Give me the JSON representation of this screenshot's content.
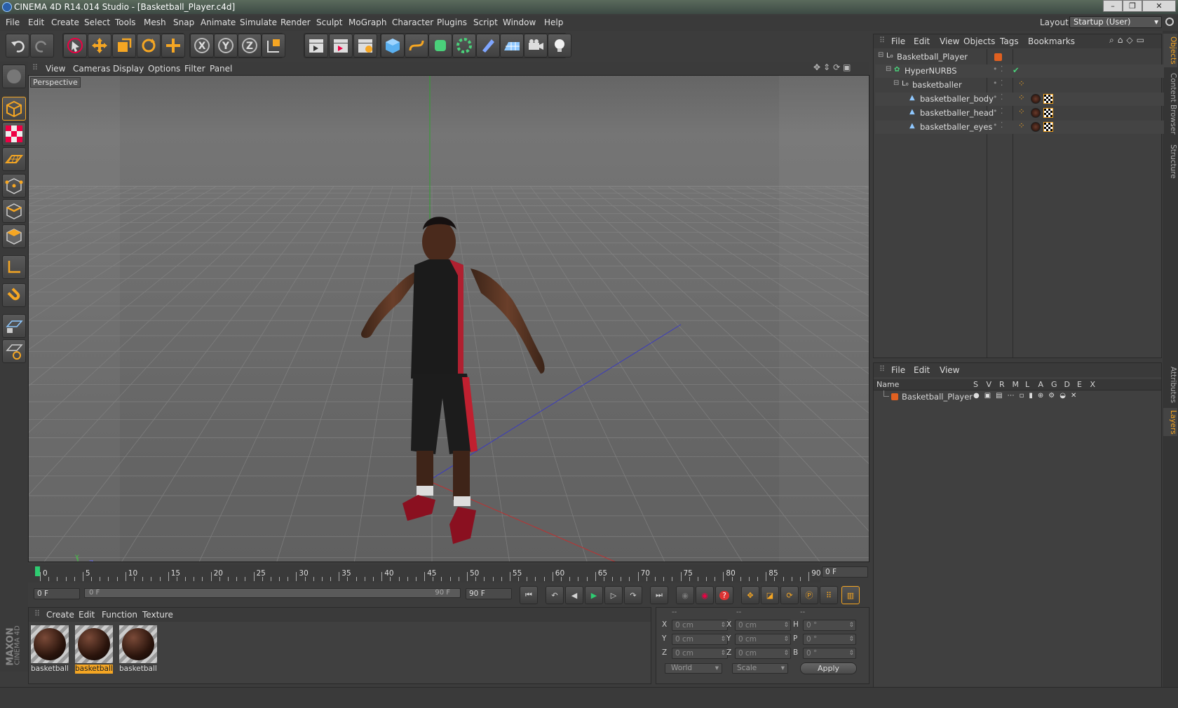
{
  "window": {
    "title": "CINEMA 4D R14.014 Studio - [Basketball_Player.c4d]"
  },
  "menu": [
    "File",
    "Edit",
    "Create",
    "Select",
    "Tools",
    "Mesh",
    "Snap",
    "Animate",
    "Simulate",
    "Render",
    "Sculpt",
    "MoGraph",
    "Character",
    "Plugins",
    "Script",
    "Window",
    "Help"
  ],
  "layout": {
    "label": "Layout:",
    "value": "Startup (User)"
  },
  "viewport": {
    "menu": [
      "View",
      "Cameras",
      "Display",
      "Options",
      "Filter",
      "Panel"
    ],
    "label": "Perspective",
    "axis_y": "Y",
    "axis_z": "Z",
    "axis_x": "X"
  },
  "objects_panel": {
    "menu": [
      "File",
      "Edit",
      "View",
      "Objects",
      "Tags",
      "Bookmarks"
    ],
    "rows": [
      {
        "name": "Basketball_Player",
        "indent": 0
      },
      {
        "name": "HyperNURBS",
        "indent": 1
      },
      {
        "name": "basketballer",
        "indent": 2
      },
      {
        "name": "basketballer_body",
        "indent": 3
      },
      {
        "name": "basketballer_head",
        "indent": 3
      },
      {
        "name": "basketballer_eyes",
        "indent": 3
      }
    ]
  },
  "layers_panel": {
    "menu": [
      "File",
      "Edit",
      "View"
    ],
    "name_header": "Name",
    "cols": [
      "S",
      "V",
      "R",
      "M",
      "L",
      "A",
      "G",
      "D",
      "E",
      "X"
    ],
    "row": "Basketball_Player"
  },
  "side_tabs": {
    "objects": "Objects",
    "content_browser": "Content Browser",
    "structure": "Structure",
    "attributes": "Attributes",
    "layers": "Layers"
  },
  "timeline": {
    "ticks": [
      "0",
      "5",
      "10",
      "15",
      "20",
      "25",
      "30",
      "35",
      "40",
      "45",
      "50",
      "55",
      "60",
      "65",
      "70",
      "75",
      "80",
      "85",
      "90"
    ],
    "current_frame": "0 F",
    "start": "0 F",
    "range_start": "0 F",
    "range_end": "90 F",
    "end": "90 F"
  },
  "materials": {
    "menu": [
      "Create",
      "Edit",
      "Function",
      "Texture"
    ],
    "items": [
      {
        "name": "basketballer",
        "selected": false
      },
      {
        "name": "basketballer",
        "selected": true
      },
      {
        "name": "basketballer",
        "selected": false
      }
    ]
  },
  "coords": {
    "headers": [
      "--",
      "--",
      "--"
    ],
    "rows": [
      {
        "l1": "X",
        "v1": "0 cm",
        "l2": "X",
        "v2": "0 cm",
        "l3": "H",
        "v3": "0 °"
      },
      {
        "l1": "Y",
        "v1": "0 cm",
        "l2": "Y",
        "v2": "0 cm",
        "l3": "P",
        "v3": "0 °"
      },
      {
        "l1": "Z",
        "v1": "0 cm",
        "l2": "Z",
        "v2": "0 cm",
        "l3": "B",
        "v3": "0 °"
      }
    ],
    "space": "World",
    "mode": "Scale",
    "apply": "Apply"
  },
  "brand": {
    "maxon": "MAXON",
    "c4d": "CINEMA 4D"
  },
  "colors": {
    "accent": "#f0a000",
    "bg": "#3c3c3c",
    "panel": "#454545",
    "highlight": "#f5a623"
  }
}
